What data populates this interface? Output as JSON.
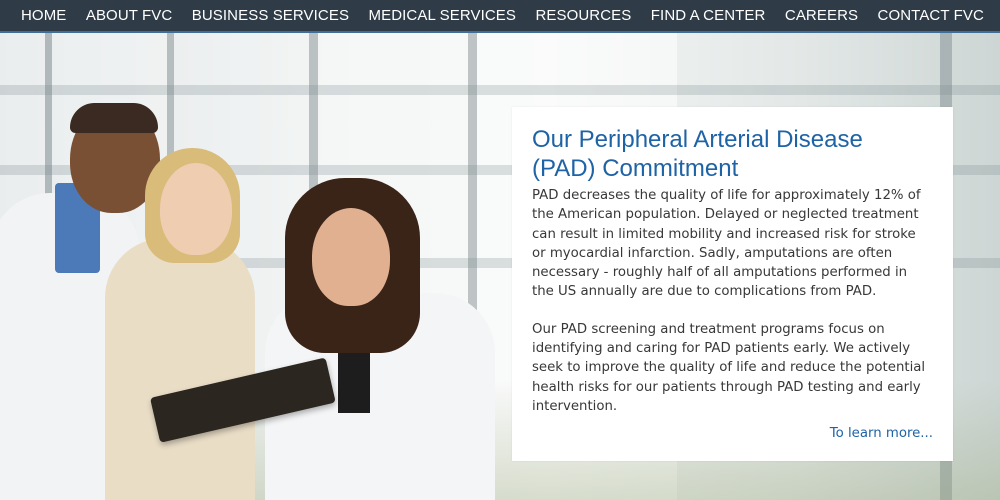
{
  "nav": {
    "items": [
      {
        "label": "HOME"
      },
      {
        "label": "ABOUT FVC"
      },
      {
        "label": "BUSINESS SERVICES"
      },
      {
        "label": "MEDICAL SERVICES"
      },
      {
        "label": "RESOURCES"
      },
      {
        "label": "FIND A CENTER"
      },
      {
        "label": "CAREERS"
      },
      {
        "label": "CONTACT FVC"
      }
    ]
  },
  "hero": {
    "image": "three medical professionals reviewing a clipboard"
  },
  "card": {
    "title": "Our Peripheral Arterial Disease (PAD) Commitment",
    "paragraph1": "PAD decreases the quality of life for approximately 12% of the American population. Delayed or neglected treatment can result in limited mobility and increased risk for stroke or myocardial infarction. Sadly, amputations are often necessary - roughly half of all amputations performed in the US annually are due to complications from PAD.",
    "paragraph2": "Our PAD screening and treatment programs focus on identifying and caring for PAD patients early. We actively seek to improve the quality of life and reduce the potential health risks for our patients through PAD testing and early intervention.",
    "link": "To learn more..."
  },
  "colors": {
    "nav_bg": "#2f3c47",
    "nav_border": "#3f6f96",
    "title_blue": "#1e63a6",
    "body_text": "#383838"
  }
}
